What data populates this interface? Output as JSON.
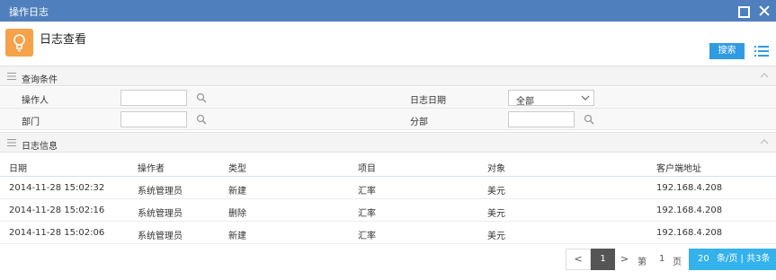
{
  "window": {
    "title": "操作日志"
  },
  "header": {
    "title": "日志查看",
    "search_label": "搜索"
  },
  "conditions": {
    "section_label": "查询条件",
    "operator_label": "操作人",
    "date_label": "日志日期",
    "date_value": "全部",
    "department_label": "部门",
    "branch_label": "分部"
  },
  "log_info": {
    "section_label": "日志信息"
  },
  "table": {
    "headers": [
      "日期",
      "操作者",
      "类型",
      "项目",
      "对象",
      "客户端地址"
    ],
    "rows": [
      [
        "2014-11-28 15:02:32",
        "系统管理员",
        "新建",
        "汇率",
        "美元",
        "192.168.4.208"
      ],
      [
        "2014-11-28 15:02:16",
        "系统管理员",
        "删除",
        "汇率",
        "美元",
        "192.168.4.208"
      ],
      [
        "2014-11-28 15:02:06",
        "系统管理员",
        "新建",
        "汇率",
        "美元",
        "192.168.4.208"
      ]
    ]
  },
  "pager": {
    "prev": "<",
    "current": "1",
    "next": ">",
    "goto_prefix": "第",
    "goto_page": "1",
    "goto_suffix": "页",
    "page_size": "20",
    "page_size_text": "条/页 | 共3条"
  },
  "colors": {
    "titlebar": "#4f7fbd",
    "accent": "#2f9be3",
    "logo": "#f6a24a",
    "pager_size": "#34b2ec"
  }
}
